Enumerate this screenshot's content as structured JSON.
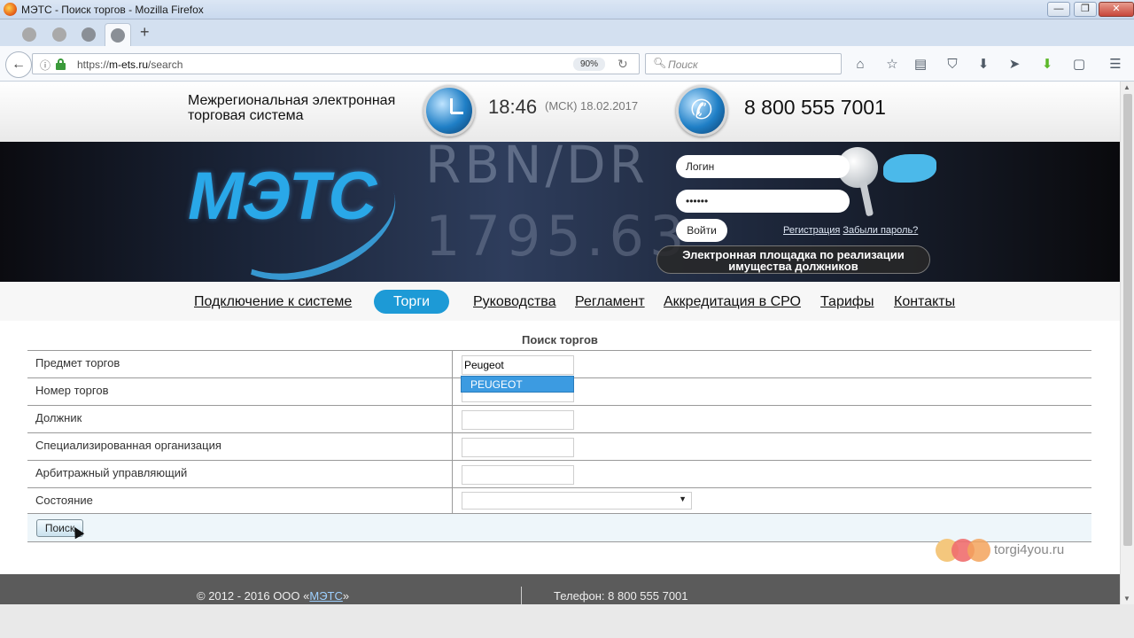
{
  "window": {
    "title": "МЭТС - Поиск торгов - Mozilla Firefox",
    "min": "—",
    "max": "❐",
    "close": "✕"
  },
  "tabs": [
    {
      "icon": "person-favicon"
    },
    {
      "icon": "person-favicon"
    },
    {
      "icon": "globe-favicon"
    },
    {
      "icon": "globe-favicon",
      "active": true
    }
  ],
  "newtab_label": "+",
  "navbar": {
    "url_prefix": "https://",
    "url_host": "m-ets.ru",
    "url_path": "/search",
    "zoom": "90%",
    "search_placeholder": "Поиск"
  },
  "site": {
    "company": "Межрегиональная электронная торговая система",
    "time": "18:46",
    "timezone_date": "(МСК) 18.02.2017",
    "phone": "8 800 555 7001",
    "logo": "МЭТС",
    "ticker_top": "RBN/DR",
    "ticker_bottom": "1795.63",
    "login": {
      "login_placeholder": "Логин",
      "password_value": "••••••",
      "submit": "Войти",
      "register": "Регистрация",
      "forgot": "Забыли пароль?"
    },
    "platform_tagline": "Электронная площадка по реализации имущества должников"
  },
  "menu": [
    {
      "label": "Подключение к системе",
      "active": false
    },
    {
      "label": "Торги",
      "active": true
    },
    {
      "label": "Руководства",
      "active": false
    },
    {
      "label": "Регламент",
      "active": false
    },
    {
      "label": "Аккредитация в СРО",
      "active": false
    },
    {
      "label": "Тарифы",
      "active": false
    },
    {
      "label": "Контакты",
      "active": false
    }
  ],
  "search": {
    "title": "Поиск торгов",
    "fields": [
      {
        "label": "Предмет торгов",
        "value": "Peugeot"
      },
      {
        "label": "Номер торгов",
        "value": ""
      },
      {
        "label": "Должник",
        "value": ""
      },
      {
        "label": "Специализированная организация",
        "value": ""
      },
      {
        "label": "Арбитражный управляющий",
        "value": ""
      },
      {
        "label": "Состояние",
        "value": ""
      }
    ],
    "autocomplete_option": "PEUGEOT",
    "button": "Поиск"
  },
  "watermark": "torgi4you.ru",
  "footer": {
    "copyright_prefix": "© 2012 - 2016 ООО «",
    "copyright_link": "МЭТС",
    "copyright_suffix": "»",
    "phone": "Телефон: 8 800 555 7001"
  },
  "colors": {
    "accent": "#1d9ad6",
    "autocomplete": "#3c9be1",
    "footer": "#5b5b5b"
  }
}
